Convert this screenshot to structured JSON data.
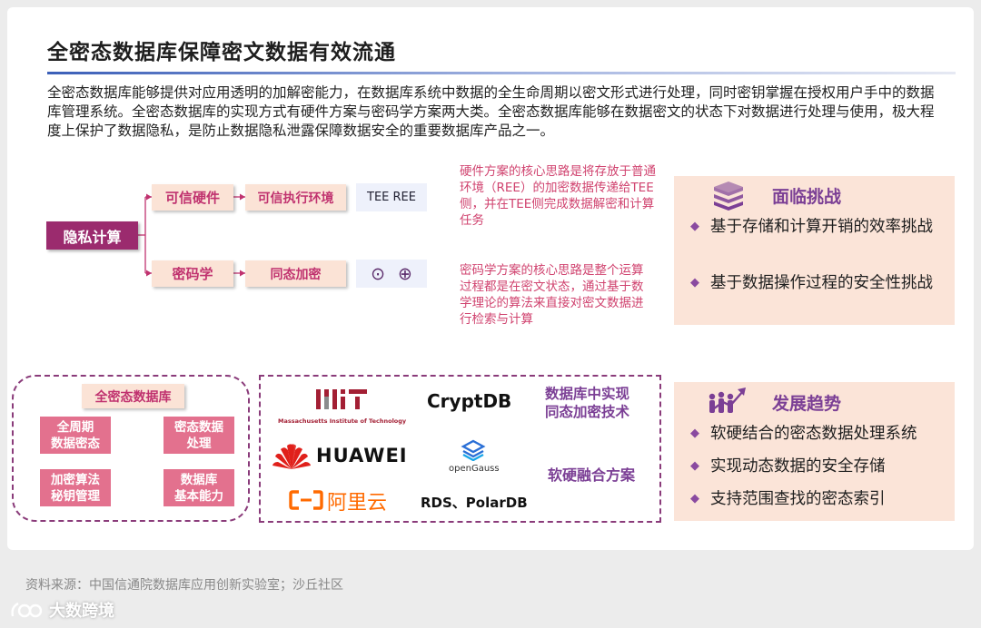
{
  "title": "全密态数据库保障密文数据有效流通",
  "intro": "全密态数据库能够提供对应用透明的加解密能力，在数据库系统中数据的全生命周期以密文形式进行处理，同时密钥掌握在授权用户手中的数据库管理系统。全密态数据库的实现方式有硬件方案与密码学方案两大类。全密态数据库能够在数据密文的状态下对数据进行处理与使用，极大程度上保护了数据隐私，是防止数据隐私泄露保障数据安全的重要数据库产品之一。",
  "tree": {
    "root": "隐私计算",
    "hardware": "可信硬件",
    "tee_env": "可信执行环境",
    "tee_tag": "TEE REE",
    "crypto": "密码学",
    "homomorphic": "同态加密",
    "op_symbols": [
      "⊙",
      "⊕"
    ]
  },
  "desc": {
    "hardware": "硬件方案的核心思路是将存放于普通环境（REE）的加密数据传递给TEE侧，并在TEE侧完成数据解密和计算任务",
    "crypto": "密码学方案的核心思路是整个运算过程都是在密文状态，通过基于数学理论的算法来直接对密文数据进行检索与计算"
  },
  "challenges": {
    "title": "面临挑战",
    "icon": "books-icon",
    "items": [
      "基于存储和计算开销的效率挑战",
      "基于数据操作过程的安全性挑战"
    ]
  },
  "trends": {
    "title": "发展趋势",
    "icon": "growth-people-icon",
    "items": [
      "软硬结合的密态数据处理系统",
      "实现动态数据的安全存储",
      "支持范围查找的密态索引"
    ]
  },
  "db": {
    "title": "全密态数据库",
    "caps": [
      "全周期\n数据密态",
      "密态数据\n处理",
      "加密算法\n秘钥管理",
      "数据库\n基本能力"
    ]
  },
  "orgs": {
    "mit_sub": "Massachusetts Institute of Technology",
    "cryptdb": "CryptDB",
    "huawei": "HUAWEI",
    "opengauss": "openGauss",
    "aliyun": "阿里云",
    "rds": "RDS、PolarDB",
    "label_he": "数据库中实现\n同态加密技术",
    "label_hybrid": "软硬融合方案"
  },
  "source": "资料来源：中国信通院数据库应用创新实验室；沙丘社区",
  "watermark": "大数跨境",
  "colors": {
    "accent_purple": "#7b3f95",
    "root_magenta": "#9b2b6e",
    "node_pink_bg": "#fbe3d6",
    "text_pink": "#d0436f",
    "cap_pink": "#e3718e",
    "rule_blue": "#3b5fb8"
  }
}
